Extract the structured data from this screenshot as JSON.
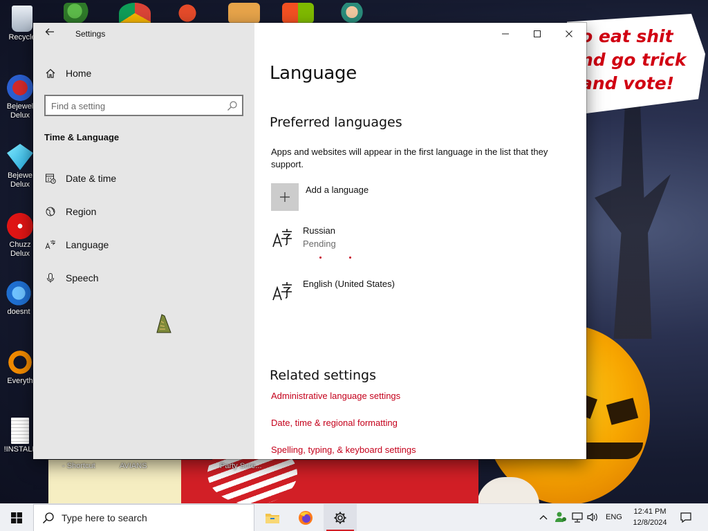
{
  "desktop": {
    "wallpaper_text": [
      "o eat shit",
      "nd go trick",
      "and vote!"
    ],
    "icons": [
      {
        "label": "Recycle",
        "name": "recycle-bin"
      },
      {
        "label": "Bejewel\nDelux",
        "name": "bejeweled-deluxe"
      },
      {
        "label": "Bejewe\nDelux",
        "name": "bejeweled-deluxe-2"
      },
      {
        "label": "Chuzz\nDelux",
        "name": "chuzzle-deluxe"
      },
      {
        "label": "doesnt",
        "name": "doesnt"
      },
      {
        "label": "Everyth",
        "name": "everything"
      },
      {
        "label": "!INSTALL",
        "name": "install"
      }
    ],
    "captions": [
      "- Shortcut",
      "AVIANS",
      "Party Scre..."
    ]
  },
  "window": {
    "app_title": "Settings",
    "controls": {
      "minimize": "—",
      "maximize": "☐",
      "close": "✕"
    }
  },
  "sidebar": {
    "home_label": "Home",
    "search_placeholder": "Find a setting",
    "section_title": "Time & Language",
    "items": [
      {
        "label": "Date & time",
        "icon": "calendar-clock-icon"
      },
      {
        "label": "Region",
        "icon": "globe-icon"
      },
      {
        "label": "Language",
        "icon": "language-icon"
      },
      {
        "label": "Speech",
        "icon": "microphone-icon"
      }
    ]
  },
  "main": {
    "title": "Language",
    "preferred_heading": "Preferred languages",
    "preferred_desc": "Apps and websites will appear in the first language in the list that they support.",
    "add_language_label": "Add a language",
    "languages": [
      {
        "name": "Russian",
        "status": "Pending"
      },
      {
        "name": "English (United States)",
        "status": ""
      }
    ],
    "related_heading": "Related settings",
    "related_links": [
      "Administrative language settings",
      "Date, time & regional formatting",
      "Spelling, typing, & keyboard settings"
    ]
  },
  "taskbar": {
    "search_text": "Type here to search",
    "pinned": [
      "file-explorer",
      "firefox",
      "settings"
    ],
    "active_app": "settings",
    "input_language": "ENG",
    "time": "12:41 PM",
    "date": "12/8/2024"
  },
  "colors": {
    "accent": "#c4001b",
    "sidebar_bg": "#e6e6e6",
    "taskbar_bg": "#eef0f4"
  }
}
